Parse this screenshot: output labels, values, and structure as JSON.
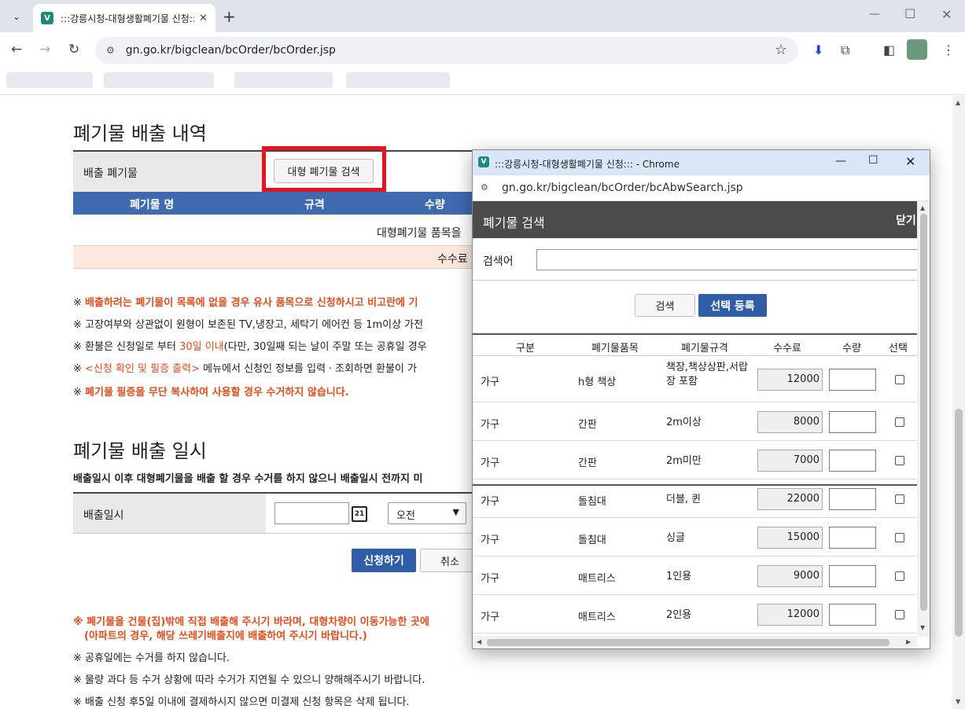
{
  "browser": {
    "tab_title": ":::강릉시청-대형생활폐기물 신청:::",
    "url": "gn.go.kr/bigclean/bcOrder/bcOrder.jsp"
  },
  "page": {
    "section1_title": "폐기물 배출 내역",
    "discharge_label": "배출 폐기물",
    "search_button": "대형 폐기물 검색",
    "table_headers": [
      "폐기물 명",
      "규격",
      "수량"
    ],
    "empty_message": "대형폐기물 품목을",
    "fee_label": "수수료",
    "notices": [
      {
        "mark": "※ ",
        "text": "배출하려는 폐기물이 목록에 없을 경우 유사 품목으로 신청하시고 비고란에 기",
        "red": true
      },
      {
        "mark": "※ ",
        "text": "고장여부와 상관없이 원형이 보존된 TV,냉장고, 세탁기 에어컨 등 1m이상 가전",
        "red": false
      },
      {
        "mark": "※ ",
        "text": "환불은 신청일로 부터 ",
        "highlight": "30일 이내",
        "rest": "(다만, 30일째 되는 날이 주말 또는 공휴일 경우",
        "red": false
      },
      {
        "mark": "※ ",
        "highlight": "<신청 확인 및 필증 출력>",
        "rest": " 메뉴에서 신청인 정보를 입력ㆍ조회하면 환불이 가",
        "red": false
      },
      {
        "mark": "※ ",
        "text": "폐기물 필증을 무단 복사하여 사용할 경우 수거하지 않습니다.",
        "red": true
      }
    ],
    "section2_title": "폐기물 배출 일시",
    "section2_desc": "배출일시 이후 대형폐기물을 배출 할 경우 수거를 하지 않으니 배출일시 전까지 미",
    "datetime_label": "배출일시",
    "date_value": "",
    "calendar_day": "21",
    "ampm_selected": "오전",
    "apply_button": "신청하기",
    "cancel_button": "취소",
    "bottom_notices": [
      {
        "text": "※ 폐기물을 건물(집)밖에 직접 배출해 주시기 바라며, 대형차량이 이동가능한 곳에",
        "red": true
      },
      {
        "text": "(아파트의 경우, 해당 쓰레기배출지에 배출하여 주시기 바랍니다.)",
        "red": true
      },
      {
        "text": "※ 공휴일에는 수거를 하지 않습니다.",
        "red": false
      },
      {
        "text": "※ 물량 과다 등 수거 상황에 따라 수거가 지연될 수 있으니 양해해주시기 바랍니다.",
        "red": false
      },
      {
        "text": "※ 배출 신청 후5일 이내에 결제하시지 않으면 미결제 신청 항목은 삭제 됩니다.",
        "red": false
      }
    ]
  },
  "popup": {
    "window_title": ":::강릉시청-대형생활폐기물 신청::: - Chrome",
    "url": "gn.go.kr/bigclean/bcOrder/bcAbwSearch.jsp",
    "header_title": "폐기물 검색",
    "close_link": "닫기",
    "search_label": "검색어",
    "search_value": "",
    "search_button": "검색",
    "register_button": "선택 등록",
    "columns": [
      "구분",
      "폐기물품목",
      "폐기물규격",
      "수수료",
      "수량",
      "선택"
    ],
    "rows": [
      {
        "category": "가구",
        "item": "h형 책상",
        "spec": "책장,책상상판,서랍장 포함",
        "fee": "12000",
        "qty": ""
      },
      {
        "category": "가구",
        "item": "간판",
        "spec": "2m이상",
        "fee": "8000",
        "qty": ""
      },
      {
        "category": "가구",
        "item": "간판",
        "spec": "2m미만",
        "fee": "7000",
        "qty": ""
      },
      {
        "category": "가구",
        "item": "돌침대",
        "spec": "더블, 퀸",
        "fee": "22000",
        "qty": ""
      },
      {
        "category": "가구",
        "item": "돌침대",
        "spec": "싱글",
        "fee": "15000",
        "qty": ""
      },
      {
        "category": "가구",
        "item": "매트리스",
        "spec": "1인용",
        "fee": "9000",
        "qty": ""
      },
      {
        "category": "가구",
        "item": "매트리스",
        "spec": "2인용",
        "fee": "12000",
        "qty": ""
      }
    ]
  },
  "colors": {
    "primary_blue": "#3e6ab0",
    "notice_red": "#e24d1e",
    "highlight_box": "#e8131f",
    "popup_header": "#4b4b4b"
  }
}
